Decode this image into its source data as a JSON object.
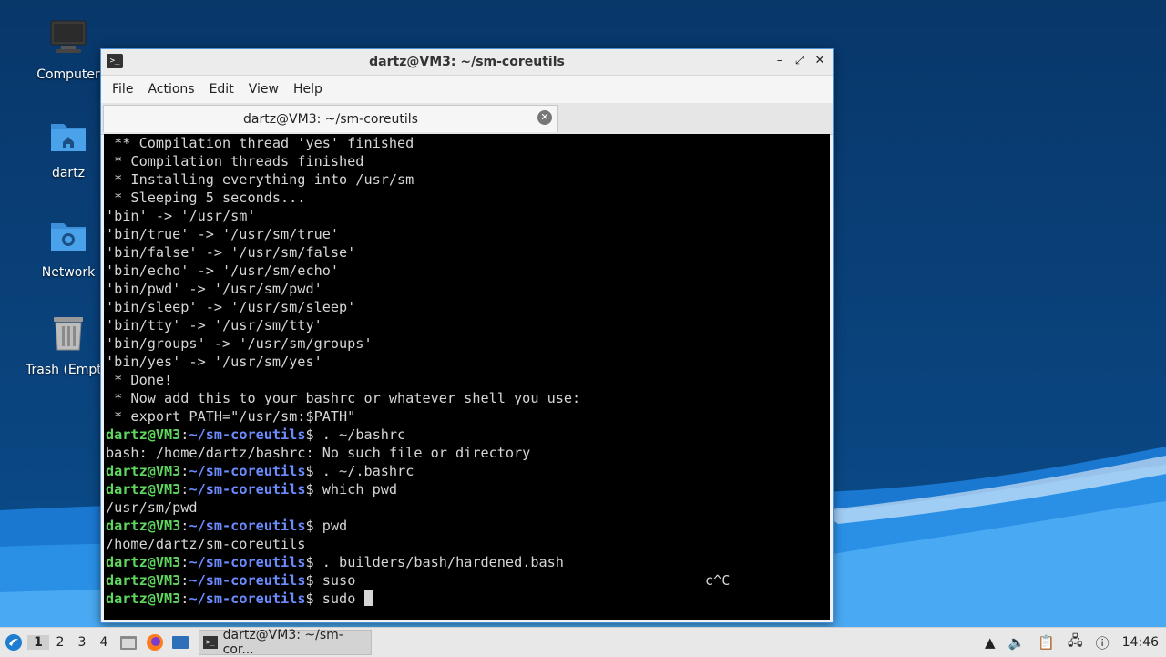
{
  "desktop": {
    "icons": [
      {
        "label": "Computer"
      },
      {
        "label": "dartz"
      },
      {
        "label": "Network"
      },
      {
        "label": "Trash (Empt"
      }
    ]
  },
  "window": {
    "title": "dartz@VM3: ~/sm-coreutils",
    "menu": [
      "File",
      "Actions",
      "Edit",
      "View",
      "Help"
    ],
    "tab_title": "dartz@VM3: ~/sm-coreutils"
  },
  "terminal": {
    "prompt_user": "dartz@VM3",
    "prompt_path": "~/sm-coreutils",
    "lines": [
      {
        "type": "out",
        "text": " ** Compilation thread 'yes' finished"
      },
      {
        "type": "out",
        "text": " * Compilation threads finished"
      },
      {
        "type": "out",
        "text": " * Installing everything into /usr/sm"
      },
      {
        "type": "out",
        "text": " * Sleeping 5 seconds..."
      },
      {
        "type": "out",
        "text": "'bin' -> '/usr/sm'"
      },
      {
        "type": "out",
        "text": "'bin/true' -> '/usr/sm/true'"
      },
      {
        "type": "out",
        "text": "'bin/false' -> '/usr/sm/false'"
      },
      {
        "type": "out",
        "text": "'bin/echo' -> '/usr/sm/echo'"
      },
      {
        "type": "out",
        "text": "'bin/pwd' -> '/usr/sm/pwd'"
      },
      {
        "type": "out",
        "text": "'bin/sleep' -> '/usr/sm/sleep'"
      },
      {
        "type": "out",
        "text": "'bin/tty' -> '/usr/sm/tty'"
      },
      {
        "type": "out",
        "text": "'bin/groups' -> '/usr/sm/groups'"
      },
      {
        "type": "out",
        "text": "'bin/yes' -> '/usr/sm/yes'"
      },
      {
        "type": "out",
        "text": " * Done!"
      },
      {
        "type": "out",
        "text": " * Now add this to your bashrc or whatever shell you use:"
      },
      {
        "type": "out",
        "text": " * export PATH=\"/usr/sm:$PATH\""
      },
      {
        "type": "cmd",
        "text": " . ~/bashrc"
      },
      {
        "type": "out",
        "text": "bash: /home/dartz/bashrc: No such file or directory"
      },
      {
        "type": "cmd",
        "text": " . ~/.bashrc"
      },
      {
        "type": "cmd",
        "text": " which pwd"
      },
      {
        "type": "out",
        "text": "/usr/sm/pwd"
      },
      {
        "type": "cmd",
        "text": " pwd"
      },
      {
        "type": "out",
        "text": "/home/dartz/sm-coreutils"
      },
      {
        "type": "cmd",
        "text": " . builders/bash/hardened.bash"
      },
      {
        "type": "cmd",
        "text": " suso",
        "right": "c^C"
      },
      {
        "type": "cmd",
        "text": " sudo ",
        "cursor": true
      }
    ]
  },
  "taskbar": {
    "workspaces": [
      "1",
      "2",
      "3",
      "4"
    ],
    "task_label": "dartz@VM3: ~/sm-cor...",
    "clock": "14:46"
  }
}
